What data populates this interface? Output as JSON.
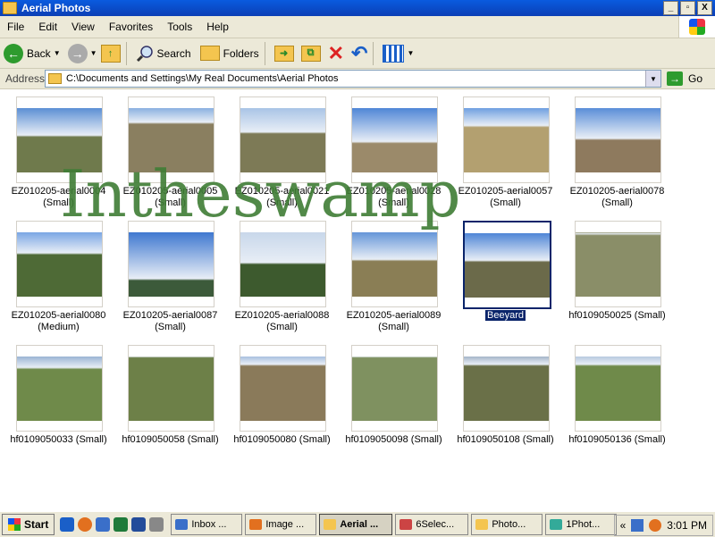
{
  "window": {
    "title": "Aerial Photos",
    "controls": [
      "_",
      "▫",
      "X"
    ]
  },
  "menu": [
    "File",
    "Edit",
    "View",
    "Favorites",
    "Tools",
    "Help"
  ],
  "toolbar": {
    "back": "Back",
    "search": "Search",
    "folders": "Folders"
  },
  "address": {
    "label": "Address",
    "value": "C:\\Documents and Settings\\My Real Documents\\Aerial Photos",
    "go": "Go"
  },
  "watermark": "Intheswamp",
  "items": [
    {
      "l1": "EZ010205-aerial0004",
      "l2": "(Small)",
      "photo": "p1"
    },
    {
      "l1": "EZ010205-aerial0005",
      "l2": "(Small)",
      "photo": "p2"
    },
    {
      "l1": "EZ010205-aerial0021",
      "l2": "(Small)",
      "photo": "p3"
    },
    {
      "l1": "EZ010205-aerial0028",
      "l2": "(Small)",
      "photo": "p4"
    },
    {
      "l1": "EZ010205-aerial0057",
      "l2": "(Small)",
      "photo": "p5"
    },
    {
      "l1": "EZ010205-aerial0078",
      "l2": "(Small)",
      "photo": "p6"
    },
    {
      "l1": "EZ010205-aerial0080",
      "l2": "(Medium)",
      "photo": "p7"
    },
    {
      "l1": "EZ010205-aerial0087",
      "l2": "(Small)",
      "photo": "p8"
    },
    {
      "l1": "EZ010205-aerial0088",
      "l2": "(Small)",
      "photo": "p9"
    },
    {
      "l1": "EZ010205-aerial0089",
      "l2": "(Small)",
      "photo": "p10"
    },
    {
      "l1": "Beeyard",
      "l2": "",
      "photo": "p11",
      "selected": true
    },
    {
      "l1": "hf0109050025 (Small)",
      "l2": "",
      "photo": "p12"
    },
    {
      "l1": "hf0109050033 (Small)",
      "l2": "",
      "photo": "p13"
    },
    {
      "l1": "hf0109050058 (Small)",
      "l2": "",
      "photo": "p14"
    },
    {
      "l1": "hf0109050080 (Small)",
      "l2": "",
      "photo": "p15"
    },
    {
      "l1": "hf0109050098 (Small)",
      "l2": "",
      "photo": "p16"
    },
    {
      "l1": "hf0109050108 (Small)",
      "l2": "",
      "photo": "p17"
    },
    {
      "l1": "hf0109050136 (Small)",
      "l2": "",
      "photo": "p18"
    }
  ],
  "taskbar": {
    "start": "Start",
    "tasks": [
      {
        "label": "Inbox ...",
        "icon": "outlook-icon",
        "color": "#3a6fc9"
      },
      {
        "label": "Image ...",
        "icon": "firefox-icon",
        "color": "#e2701f"
      },
      {
        "label": "Aerial ...",
        "icon": "folder-icon",
        "color": "#f4c54f",
        "active": true
      },
      {
        "label": "6Selec...",
        "icon": "app-icon",
        "color": "#c44"
      },
      {
        "label": "Photo...",
        "icon": "folder-icon",
        "color": "#f4c54f"
      },
      {
        "label": "1Phot...",
        "icon": "app-icon",
        "color": "#3a9"
      }
    ],
    "clock": "3:01 PM"
  }
}
